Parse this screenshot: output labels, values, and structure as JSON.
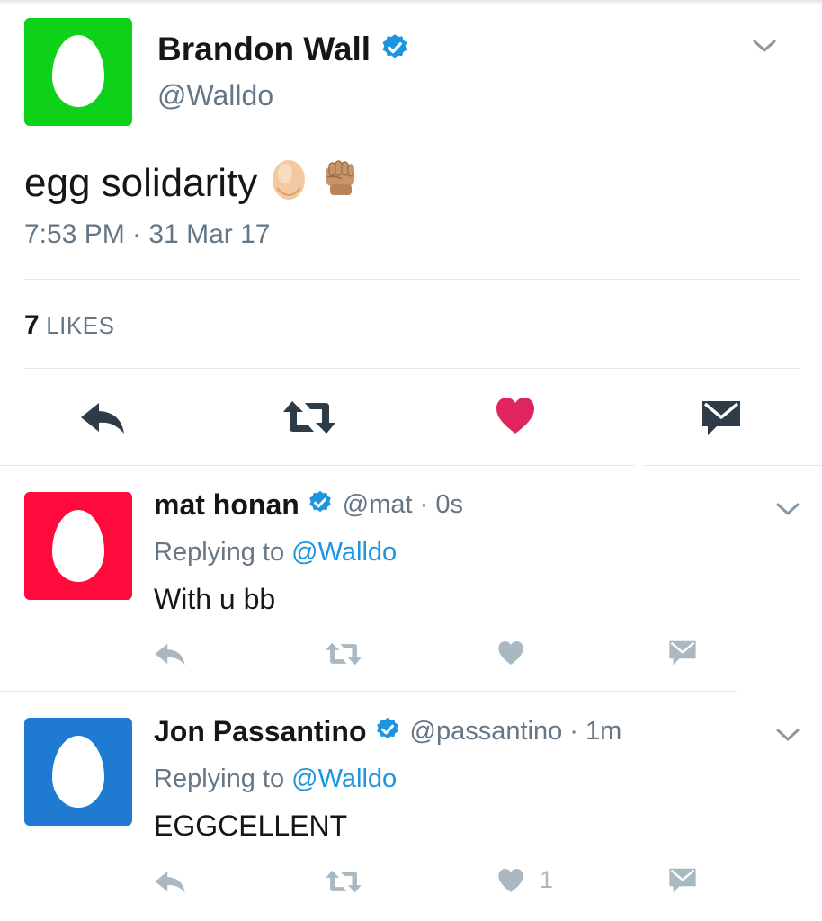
{
  "main_tweet": {
    "author_name": "Brandon Wall",
    "author_handle": "@Walldo",
    "verified": true,
    "avatar_color": "#0ed21a",
    "text": "egg solidarity",
    "emoji": [
      "egg",
      "raised-fist"
    ],
    "timestamp": "7:53 PM · 31 Mar 17",
    "likes_count": "7",
    "likes_label": "LIKES",
    "liked": true
  },
  "replies": [
    {
      "author_name": "mat honan",
      "author_handle": "@mat · 0s",
      "verified": true,
      "avatar_color": "#ff0a3c",
      "replying_prefix": "Replying to",
      "replying_to": "@Walldo",
      "text": "With u bb",
      "like_count": ""
    },
    {
      "author_name": "Jon Passantino",
      "author_handle": "@passantino · 1m",
      "verified": true,
      "avatar_color": "#1f7bd1",
      "replying_prefix": "Replying to",
      "replying_to": "@Walldo",
      "text": "EGGCELLENT",
      "like_count": "1"
    }
  ],
  "colors": {
    "verified_blue": "#1b95e0",
    "like_red": "#e0245e",
    "icon_dark": "#2f3b47",
    "icon_light": "#aab8c2",
    "link": "#1b95e0"
  }
}
